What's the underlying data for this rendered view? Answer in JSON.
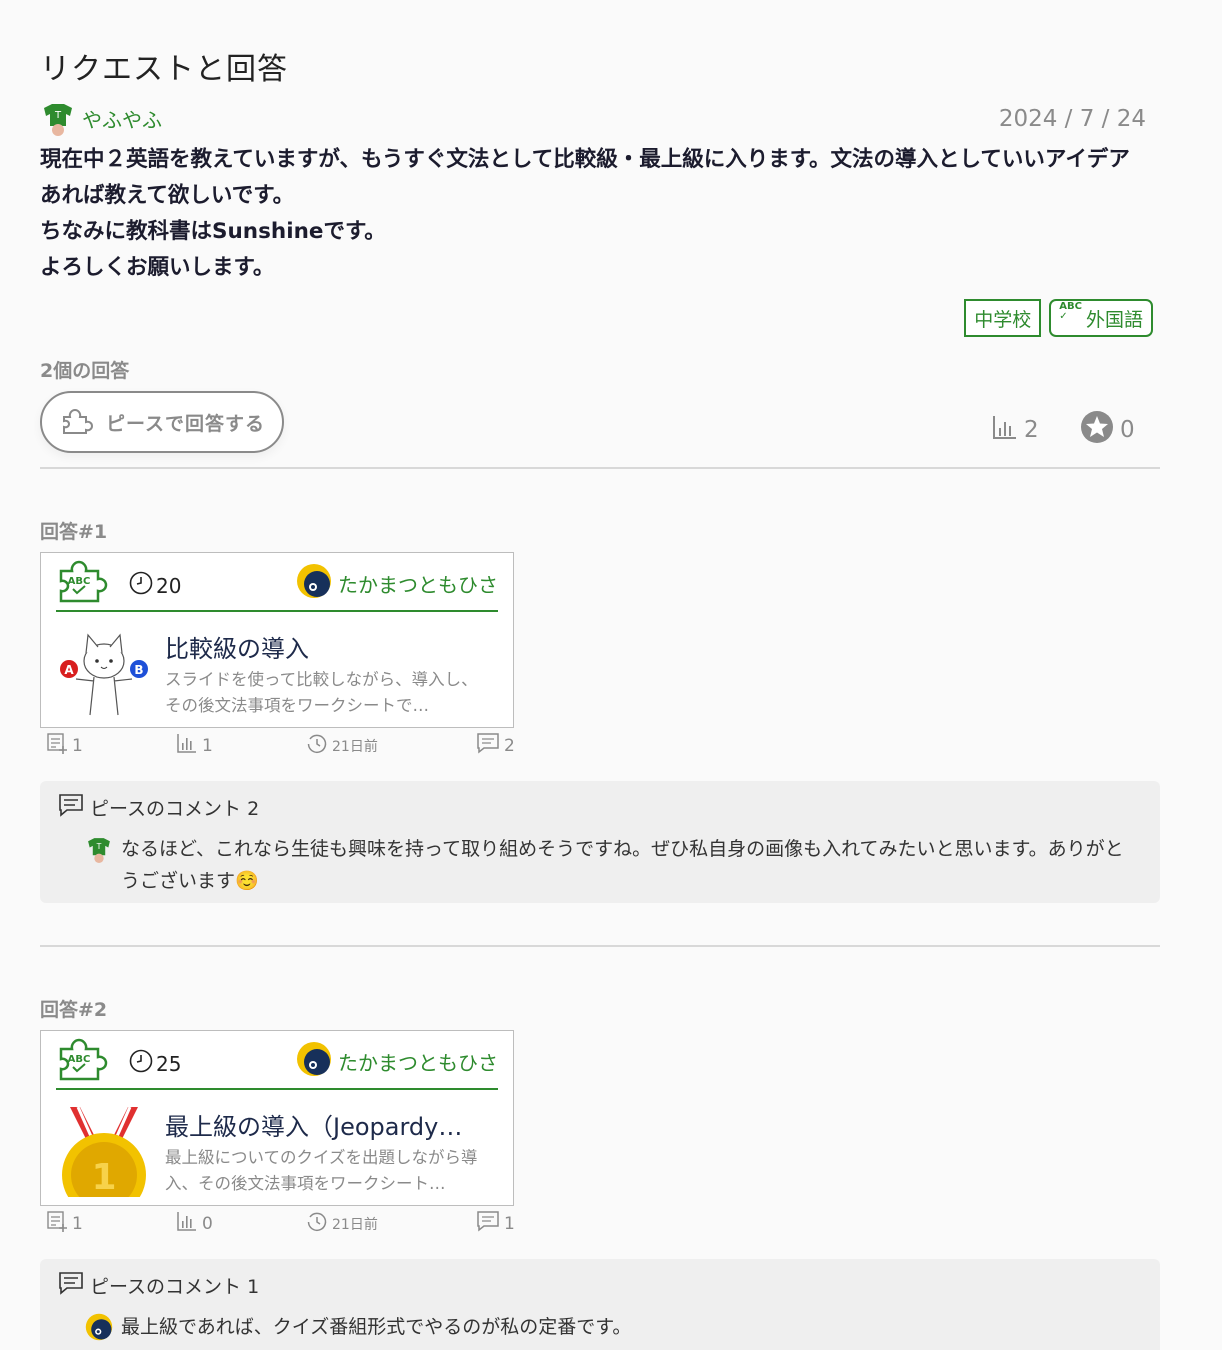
{
  "page_title": "リクエストと回答",
  "request": {
    "author": "やふやふ",
    "date": "2024 / 7 / 24",
    "body_lines": [
      "現在中２英語を教えていますが、もうすぐ文法として比較級・最上級に入ります。文法の導入としていいアイデアあれば教えて欲しいです。",
      "ちなみに教科書はSunshineです。",
      "よろしくお願いします。"
    ],
    "tags": [
      "中学校",
      "外国語"
    ],
    "tag_icon_text": "ABC"
  },
  "answer_count_label": "2個の回答",
  "answer_button_label": "ピースで回答する",
  "stats": {
    "views": "2",
    "stars": "0"
  },
  "answers": [
    {
      "label": "回答#1",
      "time": "20",
      "owner": "たかまつともひさ",
      "title": "比較級の導入",
      "desc": "スライドを使って比較しながら、導入し、その後文法事項をワークシートで…",
      "meta": {
        "used": "1",
        "views": "1",
        "ago": "21日前",
        "comments": "2"
      },
      "comment_header": "ピースのコメント 2",
      "comment_text": "なるほど、これなら生徒も興味を持って取り組めそうですね。ぜひ私自身の画像も入れてみたいと思います。ありがとうございます☺️"
    },
    {
      "label": "回答#2",
      "time": "25",
      "owner": "たかまつともひさ",
      "title": "最上級の導入（Jeopardy…",
      "desc": "最上級についてのクイズを出題しながら導入、その後文法事項をワークシート…",
      "meta": {
        "used": "1",
        "views": "0",
        "ago": "21日前",
        "comments": "1"
      },
      "comment_header": "ピースのコメント 1",
      "comment_text": "最上級であれば、クイズ番組形式でやるのが私の定番です。"
    }
  ],
  "colors": {
    "accent_green": "#2e8b2e",
    "muted": "#8a8a8a",
    "comment_bg": "#efefef"
  }
}
